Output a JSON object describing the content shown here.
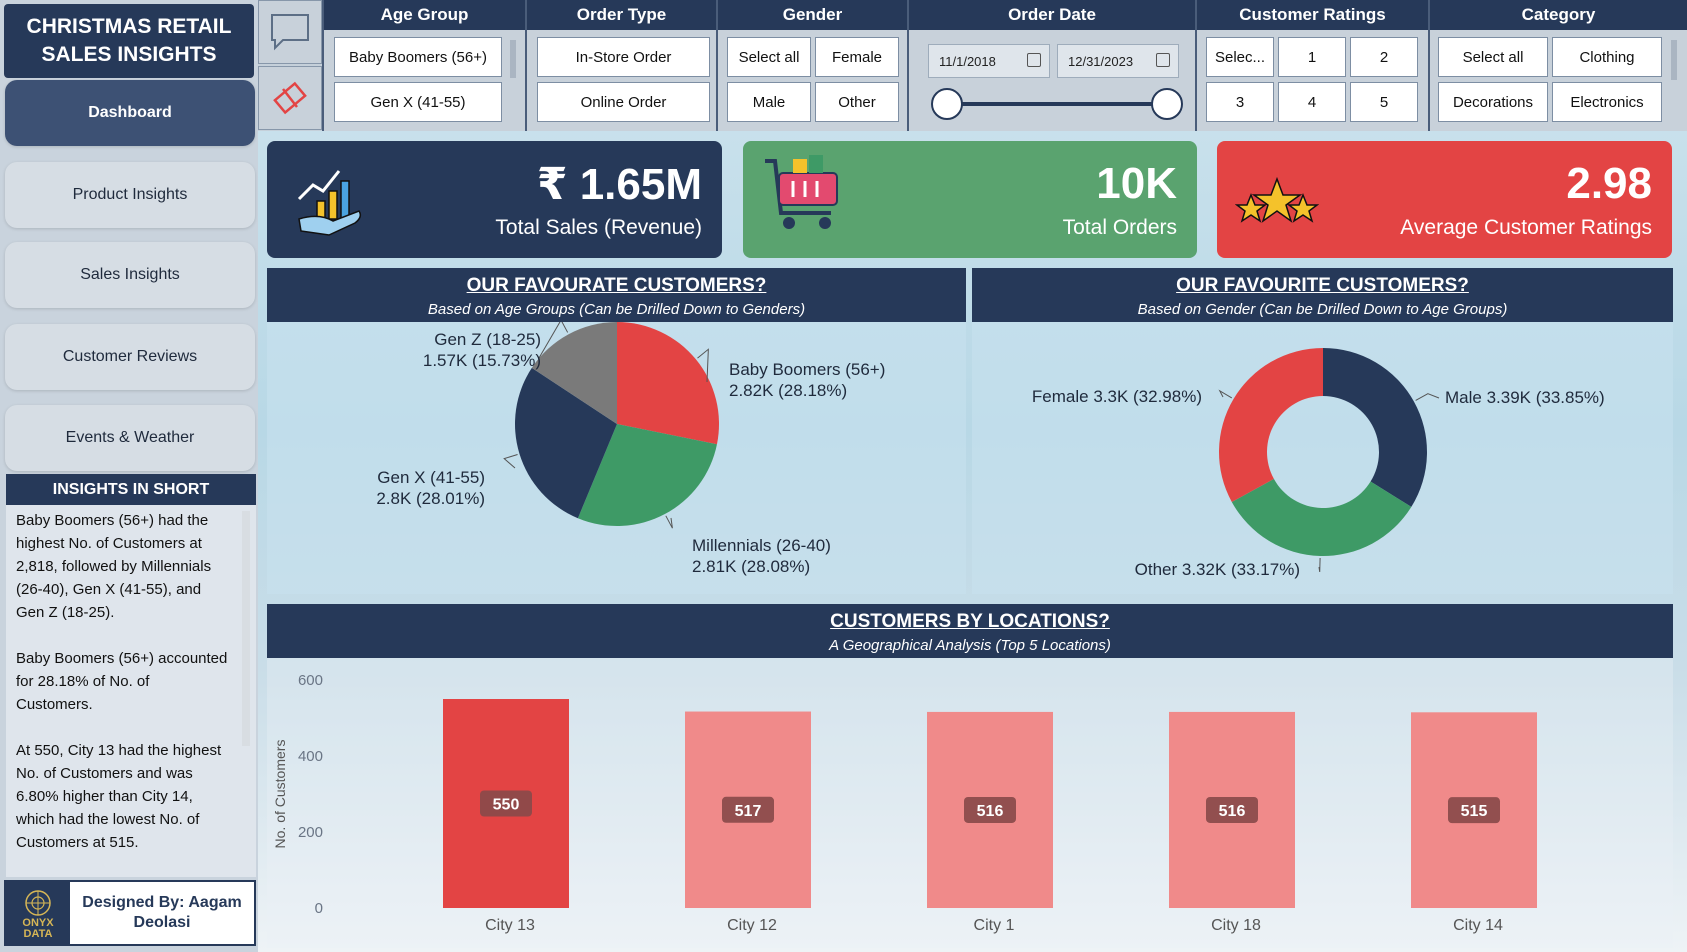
{
  "brand": {
    "line1": "CHRISTMAS RETAIL",
    "line2": "SALES INSIGHTS"
  },
  "nav": [
    {
      "label": "Dashboard",
      "active": true
    },
    {
      "label": "Product Insights",
      "active": false
    },
    {
      "label": "Sales Insights",
      "active": false
    },
    {
      "label": "Customer Reviews",
      "active": false
    },
    {
      "label": "Events & Weather",
      "active": false
    }
  ],
  "insights": {
    "title": "INSIGHTS IN SHORT",
    "p1": "Baby Boomers (56+) had the highest No. of Customers at 2,818, followed by Millennials (26-40), Gen X (41-55), and Gen Z (18-25).",
    "p2": "Baby Boomers (56+) accounted for 28.18% of No. of Customers.",
    "p3": "At 550, City 13 had the highest No. of Customers and was 6.80% higher than City 14, which had the lowest No. of Customers at 515."
  },
  "designer": {
    "logo_line1": "ONYX",
    "logo_line2": "DATA",
    "text": "Designed By: Aagam Deolasi"
  },
  "filters": {
    "age_group": {
      "title": "Age Group",
      "options": [
        "Baby Boomers (56+)",
        "Gen X (41-55)"
      ]
    },
    "order_type": {
      "title": "Order Type",
      "options": [
        "In-Store Order",
        "Online Order"
      ]
    },
    "gender": {
      "title": "Gender",
      "options": [
        "Select all",
        "Female",
        "Male",
        "Other"
      ]
    },
    "order_date": {
      "title": "Order Date",
      "start": "11/1/2018",
      "end": "12/31/2023"
    },
    "ratings": {
      "title": "Customer Ratings",
      "options": [
        "Selec...",
        "1",
        "2",
        "3",
        "4",
        "5"
      ]
    },
    "category": {
      "title": "Category",
      "options": [
        "Select all",
        "Clothing",
        "Decorations",
        "Electronics"
      ]
    }
  },
  "kpis": {
    "sales": {
      "value": "₹ 1.65M",
      "label": "Total Sales (Revenue)",
      "color": "#263959"
    },
    "orders": {
      "value": "10K",
      "label": "Total Orders",
      "color": "#5aa36f"
    },
    "ratings": {
      "value": "2.98",
      "label": "Average Customer Ratings",
      "color": "#e34444"
    }
  },
  "panels": {
    "age": {
      "title": "OUR FAVOURATE CUSTOMERS?",
      "subtitle": "Based on Age Groups (Can be Drilled Down to Genders)"
    },
    "gender": {
      "title": "OUR FAVOURITE CUSTOMERS?",
      "subtitle": "Based on Gender (Can be Drilled Down to Age Groups)"
    },
    "city": {
      "title": "CUSTOMERS BY LOCATIONS?",
      "subtitle": "A Geographical Analysis (Top 5 Locations)"
    }
  },
  "chart_data": [
    {
      "type": "pie",
      "title": "OUR FAVOURATE CUSTOMERS?",
      "slices": [
        {
          "name": "Baby Boomers (56+)",
          "label": "2.82K (28.18%)",
          "value": 2818,
          "percent": 28.18,
          "color": "#e34444"
        },
        {
          "name": "Millennials (26-40)",
          "label": "2.81K (28.08%)",
          "value": 2808,
          "percent": 28.08,
          "color": "#3e9a66"
        },
        {
          "name": "Gen X (41-55)",
          "label": "2.8K (28.01%)",
          "value": 2801,
          "percent": 28.01,
          "color": "#263959"
        },
        {
          "name": "Gen Z (18-25)",
          "label": "1.57K (15.73%)",
          "value": 1573,
          "percent": 15.73,
          "color": "#7a7a7a"
        }
      ]
    },
    {
      "type": "pie",
      "title": "OUR FAVOURITE CUSTOMERS?",
      "donut": true,
      "slices": [
        {
          "name": "Male",
          "label": "3.39K (33.85%)",
          "value": 3385,
          "percent": 33.85,
          "color": "#263959"
        },
        {
          "name": "Other",
          "label": "3.32K (33.17%)",
          "value": 3317,
          "percent": 33.17,
          "color": "#3e9a66"
        },
        {
          "name": "Female",
          "label": "3.3K (32.98%)",
          "value": 3298,
          "percent": 32.98,
          "color": "#e34444"
        }
      ]
    },
    {
      "type": "bar",
      "title": "CUSTOMERS BY LOCATIONS?",
      "categories": [
        "City 13",
        "City 12",
        "City 1",
        "City 18",
        "City 14"
      ],
      "values": [
        550,
        517,
        516,
        516,
        515
      ],
      "ylabel": "No. of Customers",
      "xlabel": "",
      "ylim": [
        0,
        600
      ],
      "yticks": [
        "0",
        "200",
        "400",
        "600"
      ],
      "highlight_color": "#e34444",
      "bar_color": "#f08a8a",
      "grid": false
    }
  ]
}
